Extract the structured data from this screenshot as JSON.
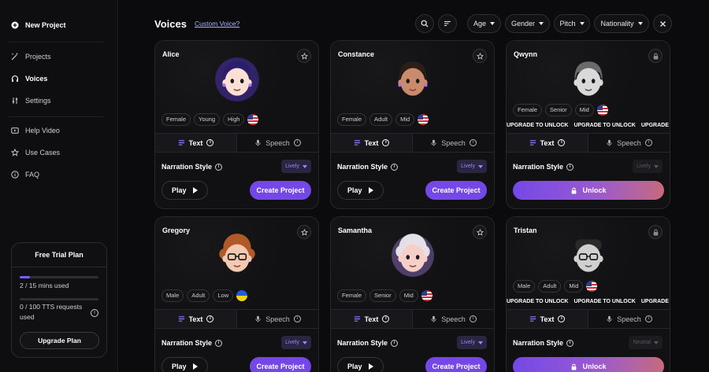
{
  "sidebar": {
    "new_project": "New Project",
    "items": [
      "Projects",
      "Voices",
      "Settings"
    ],
    "help": [
      "Help Video",
      "Use Cases",
      "FAQ"
    ],
    "trial": {
      "title": "Free Trial Plan",
      "mins_used": "2 / 15 mins used",
      "mins_fraction": 0.13,
      "tts_line1": "0 / 100 TTS requests",
      "tts_line2": "used",
      "tts_fraction": 0.0,
      "upgrade": "Upgrade Plan"
    }
  },
  "header": {
    "title": "Voices",
    "custom_voice": "Custom Voice?",
    "filters": [
      "Age",
      "Gender",
      "Pitch",
      "Nationality"
    ]
  },
  "card_labels": {
    "text_tab": "Text",
    "speech_tab": "Speech",
    "narration": "Narration Style",
    "play": "Play",
    "create": "Create Project",
    "unlock": "Unlock",
    "upgrade_strip": "UPGRADE TO UNLOCK"
  },
  "voices": [
    {
      "name": "Alice",
      "tags": [
        "Female",
        "Young",
        "High"
      ],
      "flag": "us",
      "style": "Lively",
      "locked": false
    },
    {
      "name": "Constance",
      "tags": [
        "Female",
        "Adult",
        "Mid"
      ],
      "flag": "us",
      "style": "Lively",
      "locked": false
    },
    {
      "name": "Qwynn",
      "tags": [
        "Female",
        "Senior",
        "Mid"
      ],
      "flag": "us",
      "style": "Lively",
      "locked": true
    },
    {
      "name": "Gregory",
      "tags": [
        "Male",
        "Adult",
        "Low"
      ],
      "flag": "ua",
      "style": "Lively",
      "locked": false
    },
    {
      "name": "Samantha",
      "tags": [
        "Female",
        "Senior",
        "Mid"
      ],
      "flag": "us",
      "style": "Lively",
      "locked": false
    },
    {
      "name": "Tristan",
      "tags": [
        "Male",
        "Adult",
        "Mid"
      ],
      "flag": "us",
      "style": "Neutral",
      "locked": true
    }
  ],
  "colors": {
    "accent": "#7448e8",
    "link": "#a9b4ff",
    "background": "#0b0b0d"
  }
}
